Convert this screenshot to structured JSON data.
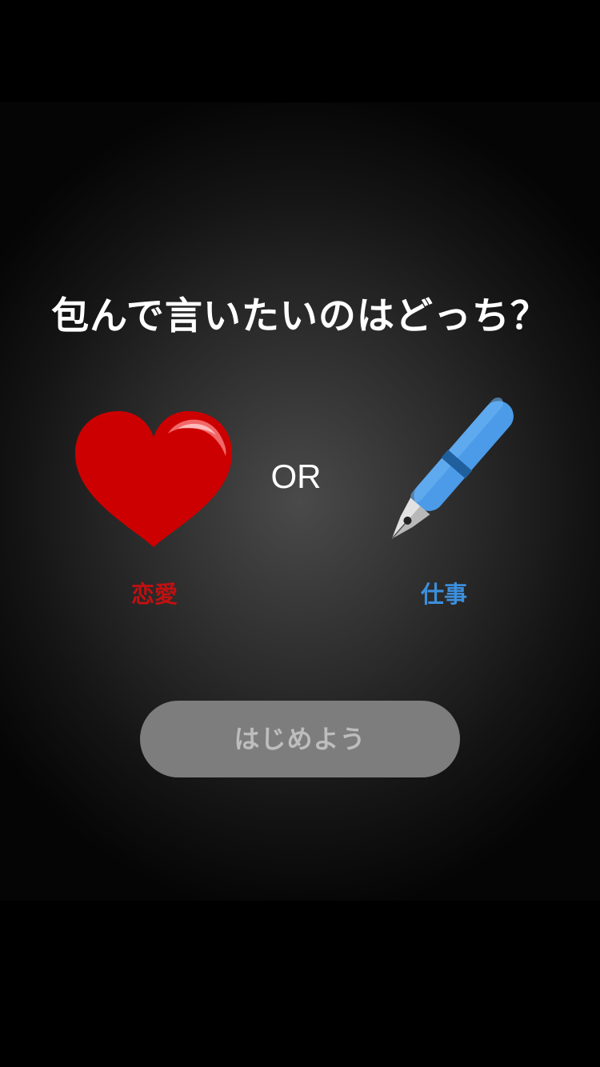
{
  "screen": {
    "question": "包んで言いたいのはどっち？",
    "separator": "OR",
    "options": [
      {
        "label": "恋愛",
        "icon": "heart-icon",
        "color": "#c01010"
      },
      {
        "label": "仕事",
        "icon": "fountain-pen-icon",
        "color": "#3d8fdc"
      }
    ],
    "start_button": {
      "label": "はじめよう",
      "state": "disabled"
    }
  },
  "colors": {
    "background": "#000000",
    "panel_center": "#4a4a4a",
    "heart": "#cc0000",
    "pen": "#4b9be8",
    "button": "#7d7d7d",
    "button_text": "#bdbdbd"
  }
}
